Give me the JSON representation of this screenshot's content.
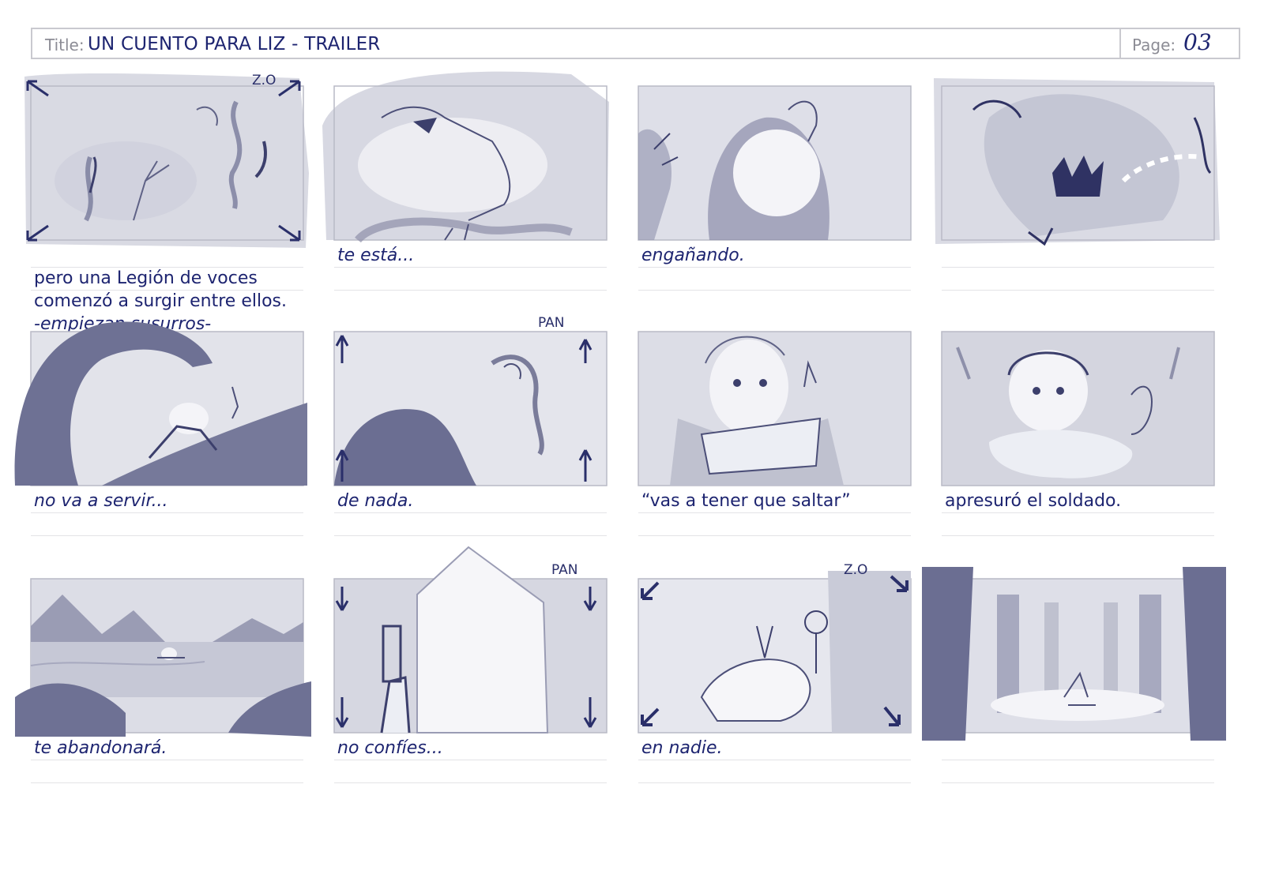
{
  "header": {
    "title_label": "Title:",
    "title_value": "UN CUENTO PARA LIZ - TRAILER",
    "page_label": "Page:",
    "page_value": "03"
  },
  "panels": [
    {
      "caption": "pero una Legión de voces\ncomenzó a surgir entre ellos.",
      "caption_italic_line": "-empiezan susurros-",
      "italic": false,
      "note": "Z.O"
    },
    {
      "caption": "te está...",
      "italic": true,
      "note": ""
    },
    {
      "caption": "engañando.",
      "italic": true,
      "note": ""
    },
    {
      "caption": "",
      "italic": false,
      "note": ""
    },
    {
      "caption": "no va a servir...",
      "italic": true,
      "note": ""
    },
    {
      "caption": "de nada.",
      "italic": true,
      "note": "PAN"
    },
    {
      "caption": "“vas a tener que saltar”",
      "italic": false,
      "note": ""
    },
    {
      "caption": "apresuró el soldado.",
      "italic": false,
      "note": ""
    },
    {
      "caption": "te abandonará.",
      "italic": true,
      "note": ""
    },
    {
      "caption": "no confíes...",
      "italic": true,
      "note": "PAN"
    },
    {
      "caption": "en nadie.",
      "italic": true,
      "note": "Z.O"
    },
    {
      "caption": "",
      "italic": false,
      "note": ""
    }
  ],
  "colors": {
    "ink": "#1d2470",
    "sketch_dark": "#5f6286",
    "sketch_mid": "#9a9cb4",
    "sketch_light": "#d6d7e1",
    "frame_border": "#b9bac6"
  }
}
